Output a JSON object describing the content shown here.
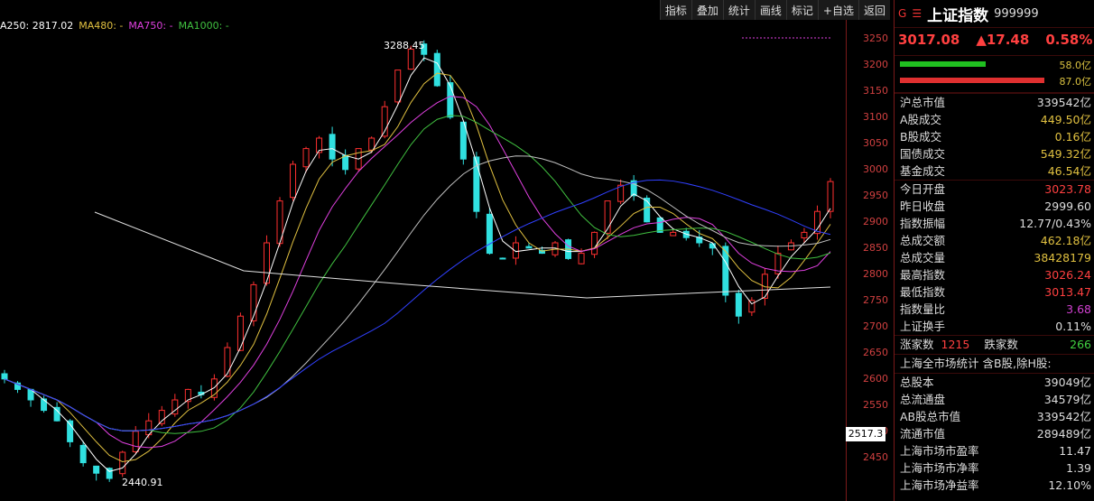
{
  "ma_legend": [
    {
      "text": "A250: 2817.02",
      "color": "#ffffff"
    },
    {
      "text": "MA480: -",
      "color": "#e0c040"
    },
    {
      "text": "MA750: -",
      "color": "#e040e0"
    },
    {
      "text": "MA1000: -",
      "color": "#40c040"
    }
  ],
  "toolbar": [
    "指标",
    "叠加",
    "统计",
    "画线",
    "标记",
    "+自选",
    "返回"
  ],
  "y_ticks": [
    "3250",
    "3200",
    "3150",
    "3100",
    "3050",
    "3000",
    "2950",
    "2900",
    "2850",
    "2800",
    "2750",
    "2700",
    "2650",
    "2600",
    "2550",
    "2500",
    "2450"
  ],
  "high_label": "3288.45",
  "low_label": "2440.91",
  "current_price_tag": "2517.3",
  "chart_data": {
    "type": "candlestick",
    "ylim": [
      2420,
      3290
    ],
    "high": 3288.45,
    "low": 2440.91,
    "close_series_approx": [
      2640,
      2620,
      2600,
      2580,
      2560,
      2520,
      2480,
      2460,
      2450,
      2500,
      2540,
      2560,
      2580,
      2600,
      2620,
      2610,
      2640,
      2700,
      2760,
      2820,
      2900,
      2980,
      3050,
      3080,
      3100,
      3060,
      3040,
      3080,
      3100,
      3160,
      3230,
      3270,
      3260,
      3200,
      3140,
      3060,
      2960,
      2880,
      2870,
      2900,
      2890,
      2880,
      2900,
      2870,
      2880,
      2920,
      2980,
      3010,
      2990,
      2940,
      2920,
      2920,
      2910,
      2900,
      2890,
      2800,
      2760,
      2790,
      2840,
      2880,
      2900,
      2920,
      2960,
      3017
    ]
  },
  "right_panel": {
    "g_icon": "G",
    "menu_icon": "☰",
    "name": "上证指数",
    "code": "999999",
    "price": "3017.08",
    "change": "▲17.48",
    "pct": "0.58%",
    "bar1_label": "58.0亿",
    "bar2_label": "87.0亿",
    "rows_a": [
      {
        "label": "沪总市值",
        "value": "339542亿",
        "cls": "c-white"
      },
      {
        "label": "A股成交",
        "value": "449.50亿",
        "cls": "c-yellow"
      },
      {
        "label": "B股成交",
        "value": "0.16亿",
        "cls": "c-yellow"
      },
      {
        "label": "国债成交",
        "value": "549.32亿",
        "cls": "c-yellow"
      },
      {
        "label": "基金成交",
        "value": "46.54亿",
        "cls": "c-yellow"
      }
    ],
    "rows_b": [
      {
        "label": "今日开盘",
        "value": "3023.78",
        "cls": "c-red"
      },
      {
        "label": "昨日收盘",
        "value": "2999.60",
        "cls": "c-white"
      },
      {
        "label": "指数振幅",
        "value": "12.77/0.43%",
        "cls": "c-white"
      },
      {
        "label": "总成交额",
        "value": "462.18亿",
        "cls": "c-yellow"
      },
      {
        "label": "总成交量",
        "value": "38428179",
        "cls": "c-yellow"
      },
      {
        "label": "最高指数",
        "value": "3026.24",
        "cls": "c-red"
      },
      {
        "label": "最低指数",
        "value": "3013.47",
        "cls": "c-red"
      },
      {
        "label": "指数量比",
        "value": "3.68",
        "cls": "c-pink"
      },
      {
        "label": "上证换手",
        "value": "0.11%",
        "cls": "c-white"
      }
    ],
    "up_label": "涨家数",
    "up_value": "1215",
    "down_label": "跌家数",
    "down_value": "266",
    "market_title": "上海全市场统计 含B股,除H股:",
    "rows_c": [
      {
        "label": "总股本",
        "value": "39049亿",
        "cls": "c-white"
      },
      {
        "label": "总流通盘",
        "value": "34579亿",
        "cls": "c-white"
      },
      {
        "label": "AB股总市值",
        "value": "339542亿",
        "cls": "c-white"
      },
      {
        "label": "流通市值",
        "value": "289489亿",
        "cls": "c-white"
      },
      {
        "label": "上海市场市盈率",
        "value": "11.47",
        "cls": "c-white"
      },
      {
        "label": "上海市场市净率",
        "value": "1.39",
        "cls": "c-white"
      },
      {
        "label": "上海市场净益率",
        "value": "12.10%",
        "cls": "c-white"
      }
    ]
  }
}
